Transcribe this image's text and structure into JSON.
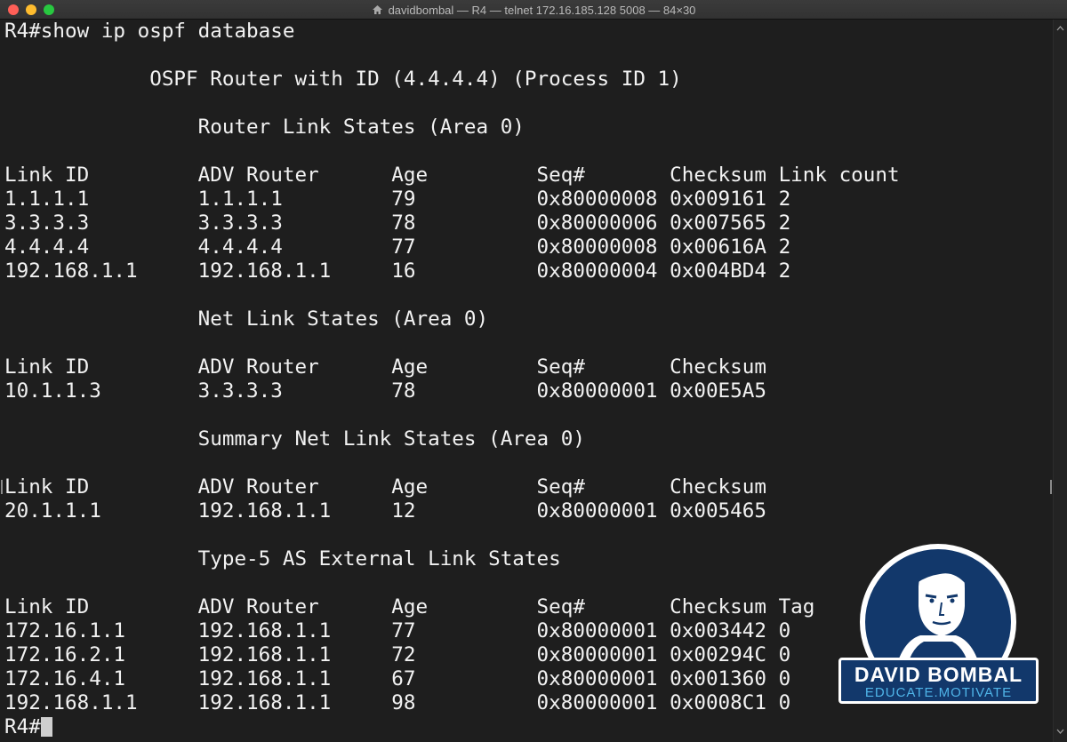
{
  "window": {
    "title": "davidbombal — R4 — telnet 172.16.185.128 5008 — 84×30"
  },
  "terminal": {
    "lines": [
      "R4#show ip ospf database",
      "",
      "            OSPF Router with ID (4.4.4.4) (Process ID 1)",
      "",
      "                Router Link States (Area 0)",
      "",
      "Link ID         ADV Router      Age         Seq#       Checksum Link count",
      "1.1.1.1         1.1.1.1         79          0x80000008 0x009161 2",
      "3.3.3.3         3.3.3.3         78          0x80000006 0x007565 2",
      "4.4.4.4         4.4.4.4         77          0x80000008 0x00616A 2",
      "192.168.1.1     192.168.1.1     16          0x80000004 0x004BD4 2",
      "",
      "                Net Link States (Area 0)",
      "",
      "Link ID         ADV Router      Age         Seq#       Checksum",
      "10.1.1.3        3.3.3.3         78          0x80000001 0x00E5A5",
      "",
      "                Summary Net Link States (Area 0)",
      "",
      "Link ID         ADV Router      Age         Seq#       Checksum",
      "20.1.1.1        192.168.1.1     12          0x80000001 0x005465",
      "",
      "                Type-5 AS External Link States",
      "",
      "Link ID         ADV Router      Age         Seq#       Checksum Tag",
      "172.16.1.1      192.168.1.1     77          0x80000001 0x003442 0",
      "172.16.2.1      192.168.1.1     72          0x80000001 0x00294C 0",
      "172.16.4.1      192.168.1.1     67          0x80000001 0x001360 0",
      "192.168.1.1     192.168.1.1     98          0x80000001 0x0008C1 0"
    ],
    "prompt": "R4#"
  },
  "logo": {
    "name": "DAVID BOMBAL",
    "tagline": "EDUCATE.MOTIVATE"
  },
  "colors": {
    "background": "#1e1e1e",
    "text": "#f2f2f2",
    "logo_blue": "#12386b",
    "logo_accent": "#4fb4e8"
  },
  "icons": {
    "home": "home-icon",
    "close": "close-icon",
    "minimize": "minimize-icon",
    "maximize": "maximize-icon"
  }
}
